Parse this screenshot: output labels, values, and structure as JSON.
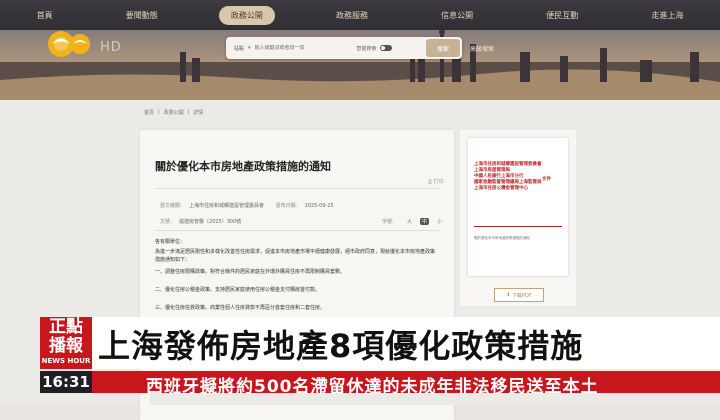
{
  "nav": {
    "items": [
      "首頁",
      "要聞動態",
      "政務公開",
      "政務服務",
      "信息公開",
      "便民互動",
      "走進上海"
    ],
    "active_index": 2
  },
  "banner": {
    "logo_text": "HD",
    "search": {
      "scope": "站點",
      "placeholder": "輸入關鍵詞或者問一問",
      "ai_label": "智能搜索",
      "button": "搜索",
      "advanced": "高級搜索"
    }
  },
  "breadcrumb": [
    "首頁",
    "政務公開",
    "詳情"
  ],
  "document": {
    "title": "關於優化本市房地產政策措施的通知",
    "print_label": "打印",
    "meta": {
      "issuer_key": "發文機關：",
      "issuer": "上海市住房和城鄉建設管理委員會",
      "date_key": "發布日期：",
      "date": "2025-09-25",
      "number_key": "文號：",
      "number": "滬建房管聯〔2025〕300號"
    },
    "font_size_label": "字號：",
    "font_sizes": [
      "大",
      "中",
      "小"
    ],
    "active_font_size": 1,
    "paragraphs": [
      "各有關單位：",
      "為進一步滿足居民剛性和多樣化改善性住房需求，促進本市房地產市場平穩健康發展，經市政府同意，現就優化本市房地產政策措施通知如下：",
      "一、調整住房限購政策。對符合條件的居民家庭在外環外購買住房不再限制購買套數。",
      "二、優化住房公積金政策。支持居民家庭使用住房公積金支付購房首付款。",
      "三、優化住房信貸政策。商業性個人住房貸款不再區分首套住房和二套住房。"
    ]
  },
  "preview": {
    "header_lines": [
      "上海市住房和城鄉建設管理委員會",
      "上海市房屋管理局",
      "中國人民銀行上海市分行",
      "國家金融監督管理總局上海監管局",
      "上海市住房公積金管理中心"
    ],
    "side_text": "文件",
    "small_text": "關於優化本市房地產政策措施的通知",
    "download": "下載PDF"
  },
  "overlay": {
    "brand_cn_line1": "正點",
    "brand_cn_line2": "播報",
    "brand_en": "NEWS HOUR",
    "headline": "上海發佈房地產8項優化政策措施",
    "time": "16:31",
    "ticker": "西班牙擬將約500名滯留休達的未成年非法移民送至本土"
  },
  "colors": {
    "brand_red": "#c8161d",
    "nav_bg": "#2f2e33",
    "nav_active": "#d9c7ad",
    "accent_gold": "#c8b296"
  }
}
